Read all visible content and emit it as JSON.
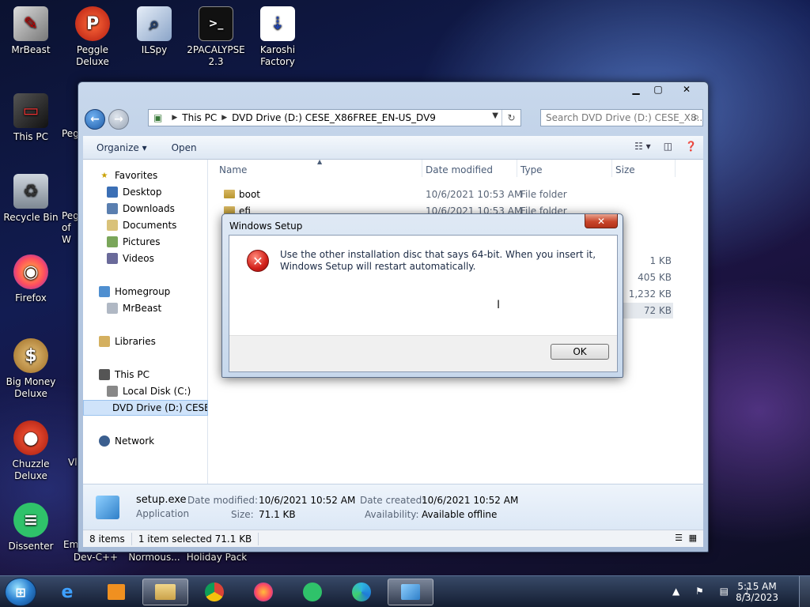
{
  "desktop": {
    "icons": [
      {
        "label": "MrBeast",
        "glyph": "✎"
      },
      {
        "label": "Peggle Deluxe",
        "glyph": "P"
      },
      {
        "label": "ILSpy",
        "glyph": "⌕"
      },
      {
        "label": "2PACALYPSE 2.3",
        "glyph": ">_"
      },
      {
        "label": "Karoshi Factory",
        "glyph": "⇣"
      },
      {
        "label": "This PC",
        "glyph": "▭"
      },
      {
        "label": "Recycle Bin",
        "glyph": "♻"
      },
      {
        "label": "Firefox",
        "glyph": "◉"
      },
      {
        "label": "Big Money Deluxe",
        "glyph": "$"
      },
      {
        "label": "Chuzzle Deluxe",
        "glyph": "●"
      },
      {
        "label": "Dissenter",
        "glyph": "≡"
      }
    ],
    "partial_labels": [
      "Peg",
      "Peg of W",
      "Vl",
      "Em",
      "Dev-C++",
      "Normous...",
      "Holiday Pack"
    ]
  },
  "explorer": {
    "address": {
      "root": "This PC",
      "location": "DVD Drive (D:) CESE_X86FREE_EN-US_DV9"
    },
    "search_placeholder": "Search DVD Drive (D:) CESE_X8...",
    "toolbar": {
      "organize": "Organize ▾",
      "open": "Open"
    },
    "nav": {
      "favorites": "Favorites",
      "desktop": "Desktop",
      "downloads": "Downloads",
      "documents": "Documents",
      "pictures": "Pictures",
      "videos": "Videos",
      "homegroup": "Homegroup",
      "user": "MrBeast",
      "libraries": "Libraries",
      "this_pc": "This PC",
      "local_disk": "Local Disk (C:)",
      "dvd_drive": "DVD Drive (D:) CESE_",
      "network": "Network"
    },
    "columns": {
      "name": "Name",
      "date": "Date modified",
      "type": "Type",
      "size": "Size"
    },
    "rows": [
      {
        "name": "boot",
        "date": "10/6/2021 10:53 AM",
        "type": "File folder",
        "size": ""
      },
      {
        "name": "efi",
        "date": "10/6/2021 10:53 AM",
        "type": "File folder",
        "size": ""
      }
    ],
    "partial_sizes": [
      "1 KB",
      "405 KB",
      "1,232 KB",
      "72 KB"
    ],
    "details": {
      "file_name": "setup.exe",
      "file_type": "Application",
      "modified_label": "Date modified:",
      "modified_value": "10/6/2021 10:52 AM",
      "size_label": "Size:",
      "size_value": "71.1 KB",
      "created_label": "Date created:",
      "created_value": "10/6/2021 10:52 AM",
      "availability_label": "Availability:",
      "availability_value": "Available offline"
    },
    "status": {
      "count": "8 items",
      "selected": "1 item selected  71.1 KB"
    }
  },
  "dialog": {
    "title": "Windows Setup",
    "message": "Use the other installation disc that says 64-bit. When you insert it, Windows Setup will restart automatically.",
    "ok_label": "OK"
  },
  "tray": {
    "time": "5:15 AM",
    "date": "8/3/2023"
  }
}
